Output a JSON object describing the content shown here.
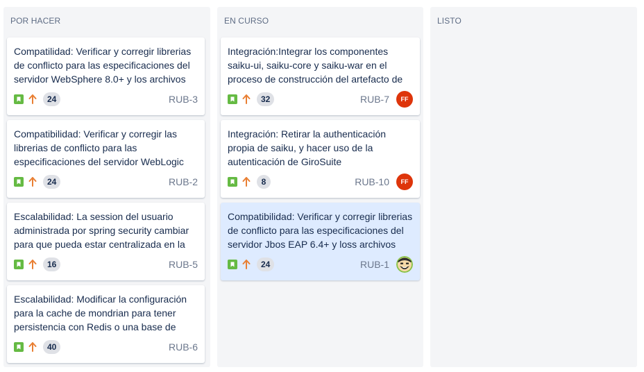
{
  "columns": [
    {
      "title": "POR HACER",
      "cards": [
        {
          "summary": "Compatilidad: Verificar y corregir librerias de conflicto para las especificaciones del servidor WebSphere 8.0+ y los archivos",
          "points": "24",
          "key": "RUB-3"
        },
        {
          "summary": "Compatibilidad: Verificar y corregir las librerias de conflicto para las especificaciones del servidor WebLogic",
          "points": "24",
          "key": "RUB-2"
        },
        {
          "summary": "Escalabilidad: La session del usuario administrada por spring security cambiar para que pueda estar centralizada en la",
          "points": "16",
          "key": "RUB-5"
        },
        {
          "summary": "Escalabilidad: Modificar la configuración para la cache de mondrian para tener persistencia con Redis o una base de",
          "points": "40",
          "key": "RUB-6"
        }
      ]
    },
    {
      "title": "EN CURSO",
      "cards": [
        {
          "summary": "Integración:Integrar los componentes saiku-ui, saiku-core y saiku-war en el proceso de construcción del artefacto de",
          "points": "32",
          "key": "RUB-7",
          "assignee_initials": "FF"
        },
        {
          "summary": "Integración: Retirar la authenticación propia de saiku, y hacer uso de la autenticación de GiroSuite",
          "points": "8",
          "key": "RUB-10",
          "assignee_initials": "FF"
        },
        {
          "summary": "Compatibilidad: Verificar y corregir librerias de conflicto para las especificaciones del servidor Jbos EAP 6.4+ y loss archivos",
          "points": "24",
          "key": "RUB-1",
          "assignee_avatar": "cartoon-face-avatar"
        }
      ]
    },
    {
      "title": "LISTO",
      "cards": []
    }
  ],
  "icons": {
    "issue_type": "story-icon",
    "priority": "priority-high-arrow-icon"
  },
  "colors": {
    "story": "#65ba43",
    "priority": "#e97f33",
    "avatar_initials_bg": "#de350b",
    "selected_card": "#deebff"
  }
}
